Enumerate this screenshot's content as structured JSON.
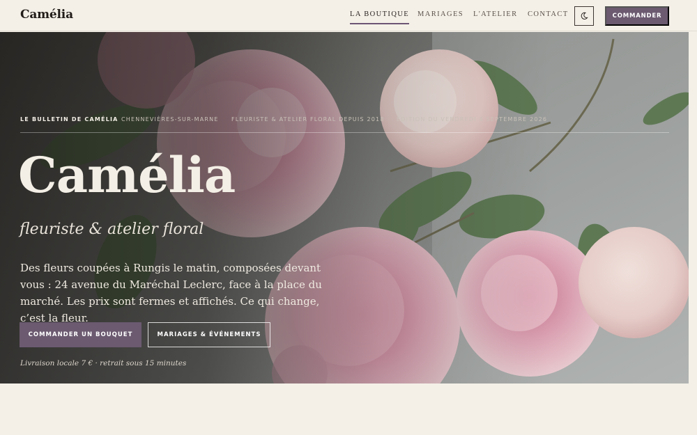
{
  "header": {
    "brand": "Camélia",
    "nav": [
      {
        "label": "LA BOUTIQUE",
        "active": true
      },
      {
        "label": "MARIAGES",
        "active": false
      },
      {
        "label": "L'ATELIER",
        "active": false
      },
      {
        "label": "CONTACT",
        "active": false
      }
    ],
    "theme_toggle_icon": "moon-icon",
    "order_label": "COMMANDER"
  },
  "hero": {
    "bulletin": [
      "LE BULLETIN DE CAMÉLIA",
      "CHENNEVIÈRES-SUR-MARNE",
      "FLEURISTE & ATELIER FLORAL DEPUIS 2018",
      "ÉDITION DU VENDREDI 4 SEPTEMBRE 2026"
    ],
    "title": "Camélia",
    "subtitle": "fleuriste & atelier floral",
    "description": "Des fleurs coupées à Rungis le matin, composées devant vous : 24 avenue du Maréchal Leclerc, face à la place du marché. Les prix sont fermes et affichés. Ce qui change, c’est la fleur.",
    "cta_primary": "COMMANDER UN BOUQUET",
    "cta_secondary": "MARIAGES & ÉVÉNEMENTS",
    "note": "Livraison locale 7 € · retrait sous 15 minutes"
  },
  "colors": {
    "accent": "#6b5a70",
    "background": "#f4f0e8",
    "text_dark": "#221c18"
  }
}
